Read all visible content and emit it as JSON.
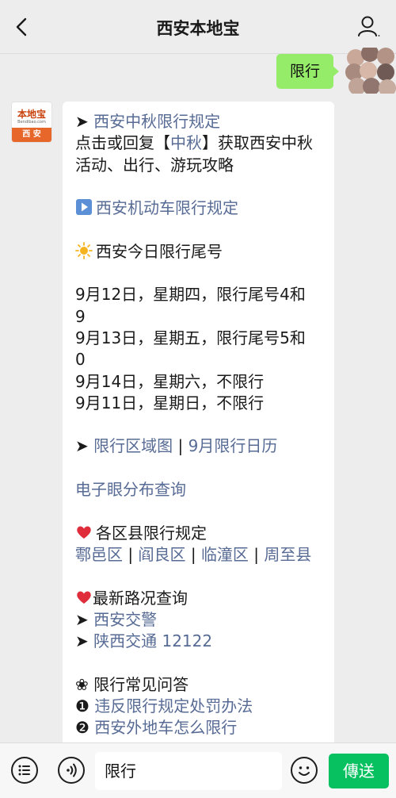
{
  "header": {
    "title": "西安本地宝",
    "back_icon": "chevron-left-icon",
    "profile_icon": "person-icon"
  },
  "my_message": {
    "text": "限行"
  },
  "bot_avatar": {
    "logo": "本地宝",
    "url": "Bendibao.com",
    "city": "西 安"
  },
  "message": {
    "arrow": "➤",
    "mid_autumn_title": "西安中秋限行规定",
    "mid_autumn_desc_1": "点击或回复【",
    "mid_autumn_keyword": "中秋",
    "mid_autumn_desc_2": "】获取西安中秋",
    "mid_autumn_desc_3": "活动、出行、游玩攻略",
    "motor_rules": "西安机动车限行规定",
    "today_title": "西安今日限行尾号",
    "schedule": [
      "9月12日，星期四，限行尾号4和",
      "9",
      "9月13日，星期五，限行尾号5和",
      "0",
      "9月14日，星期六，不限行",
      "9月11日，星期日，不限行"
    ],
    "zone_map": "限行区域图",
    "separator": "|",
    "calendar": "9月限行日历",
    "cameras": "电子眼分布查询",
    "district_title": "各区县限行规定",
    "districts": [
      "鄠邑区",
      "阎良区",
      "临潼区",
      "周至县"
    ],
    "road_title": "最新路况查询",
    "traffic_police": "西安交警",
    "shaanxi_traffic": "陕西交通 12122",
    "faq_symbol": "❀",
    "faq_title": "限行常见问答",
    "faq_items": [
      {
        "num": "❶",
        "text": "违反限行规定处罚办法"
      },
      {
        "num": "❷",
        "text": "西安外地车怎么限行"
      }
    ]
  },
  "input_bar": {
    "text": "限行",
    "send_label": "傳送",
    "menu_icon": "menu-list-icon",
    "voice_icon": "voice-icon",
    "emoji_icon": "emoji-icon"
  },
  "colors": {
    "link": "#576b95",
    "my_bubble": "#95ec69",
    "send_button": "#07c160"
  }
}
